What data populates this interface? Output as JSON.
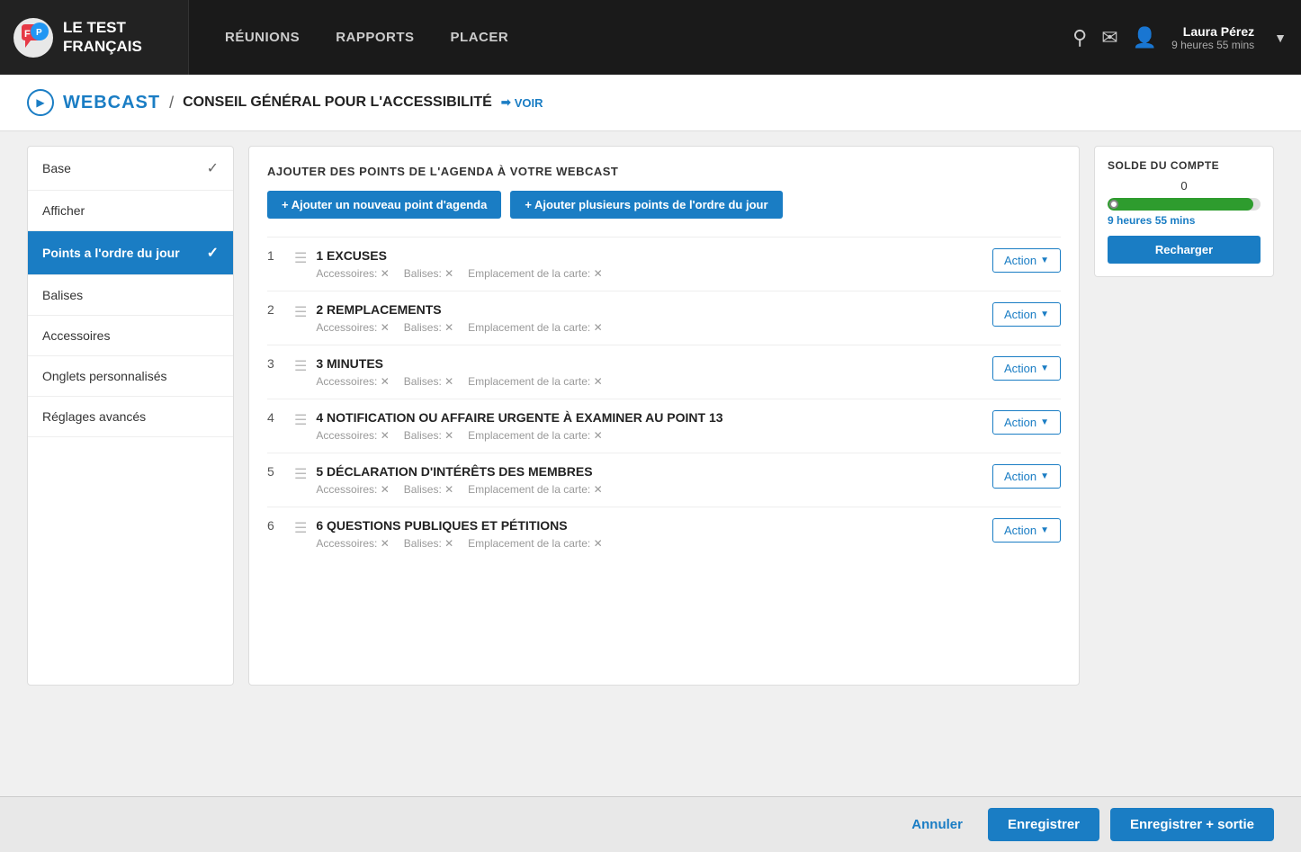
{
  "app": {
    "logo_line1": "LE TEST",
    "logo_line2": "FRANÇAIS"
  },
  "navbar": {
    "links": [
      "RÉUNIONS",
      "RAPPORTS",
      "PLACER"
    ],
    "user_name": "Laura Pérez",
    "user_time": "9 heures 55 mins"
  },
  "breadcrumb": {
    "type": "WEBCAST",
    "separator": "/",
    "title": "CONSEIL GÉNÉRAL POUR L'ACCESSIBILITÉ",
    "voir_label": "VOIR"
  },
  "sidebar": {
    "items": [
      {
        "label": "Base",
        "has_check": true,
        "active": false
      },
      {
        "label": "Afficher",
        "has_check": false,
        "active": false
      },
      {
        "label": "Points a l'ordre du jour",
        "has_check": true,
        "active": true
      },
      {
        "label": "Balises",
        "has_check": false,
        "active": false
      },
      {
        "label": "Accessoires",
        "has_check": false,
        "active": false
      },
      {
        "label": "Onglets personnalisés",
        "has_check": false,
        "active": false
      },
      {
        "label": "Réglages avancés",
        "has_check": false,
        "active": false
      }
    ]
  },
  "content": {
    "header": "AJOUTER DES POINTS DE L'AGENDA À VOTRE WEBCAST",
    "btn_add_single": "+ Ajouter un nouveau point d'agenda",
    "btn_add_multiple": "+ Ajouter plusieurs points de l'ordre du jour",
    "agenda_items": [
      {
        "number": "1",
        "title": "1 EXCUSES",
        "meta": [
          "Accessoires: ✕",
          "Balises: ✕",
          "Emplacement de la carte: ✕"
        ]
      },
      {
        "number": "2",
        "title": "2 REMPLACEMENTS",
        "meta": [
          "Accessoires: ✕",
          "Balises: ✕",
          "Emplacement de la carte: ✕"
        ]
      },
      {
        "number": "3",
        "title": "3 MINUTES",
        "meta": [
          "Accessoires: ✕",
          "Balises: ✕",
          "Emplacement de la carte: ✕"
        ]
      },
      {
        "number": "4",
        "title": "4 NOTIFICATION OU AFFAIRE URGENTE À EXAMINER AU POINT 13",
        "meta": [
          "Accessoires: ✕",
          "Balises: ✕",
          "Emplacement de la carte: ✕"
        ]
      },
      {
        "number": "5",
        "title": "5 DÉCLARATION D'INTÉRÊTS DES MEMBRES",
        "meta": [
          "Accessoires: ✕",
          "Balises: ✕",
          "Emplacement de la carte: ✕"
        ]
      },
      {
        "number": "6",
        "title": "6 QUESTIONS PUBLIQUES ET PÉTITIONS",
        "meta": [
          "Accessoires: ✕",
          "Balises: ✕",
          "Emplacement de la carte: ✕"
        ]
      }
    ],
    "action_label": "Action"
  },
  "balance": {
    "title": "SOLDE DU COMPTE",
    "amount": "0",
    "time": "9 heures 55 mins",
    "progress_pct": 95,
    "btn_recharge": "Recharger"
  },
  "footer": {
    "btn_annuler": "Annuler",
    "btn_enregistrer": "Enregistrer",
    "btn_enregistrer_sortie": "Enregistrer + sortie"
  }
}
